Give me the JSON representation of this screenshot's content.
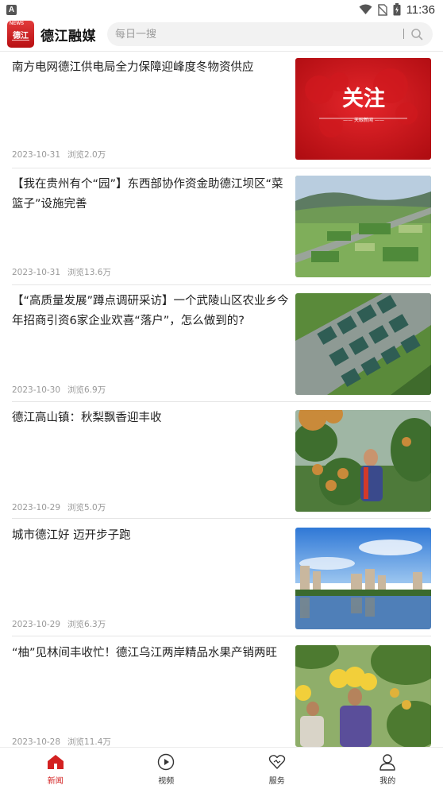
{
  "status_bar": {
    "time": "11:36",
    "indicator": "A"
  },
  "header": {
    "app_name": "德江融媒",
    "logo_text": "德江",
    "logo_small": "NEWS",
    "search_placeholder": "每日一搜"
  },
  "news": [
    {
      "title": "南方电网德江供电局全力保障迎峰度冬物资供应",
      "date": "2023-10-31",
      "views": "浏览2.0万",
      "thumb_text": "关注",
      "thumb_sub": "—— 天眼新闻 ——"
    },
    {
      "title": "【我在贵州有个“园”】东西部协作资金助德江坝区“菜篮子”设施完善",
      "date": "2023-10-31",
      "views": "浏览13.6万"
    },
    {
      "title": "【“高质量发展”蹲点调研采访】一个武陵山区农业乡今年招商引资6家企业欢喜“落户”，怎么做到的?",
      "date": "2023-10-30",
      "views": "浏览6.9万"
    },
    {
      "title": "德江高山镇：秋梨飘香迎丰收",
      "date": "2023-10-29",
      "views": "浏览5.0万"
    },
    {
      "title": "城市德江好 迈开步子跑",
      "date": "2023-10-29",
      "views": "浏览6.3万"
    },
    {
      "title": "“柚”见林间丰收忙！德江乌江两岸精品水果产销两旺",
      "date": "2023-10-28",
      "views": "浏览11.4万"
    }
  ],
  "bottom_nav": [
    {
      "label": "新闻",
      "icon": "home-icon",
      "active": true
    },
    {
      "label": "视频",
      "icon": "play-icon",
      "active": false
    },
    {
      "label": "服务",
      "icon": "heart-icon",
      "active": false
    },
    {
      "label": "我的",
      "icon": "user-icon",
      "active": false
    }
  ],
  "colors": {
    "accent": "#d32121",
    "meta_text": "#999999",
    "divider": "#e6e6e6"
  }
}
